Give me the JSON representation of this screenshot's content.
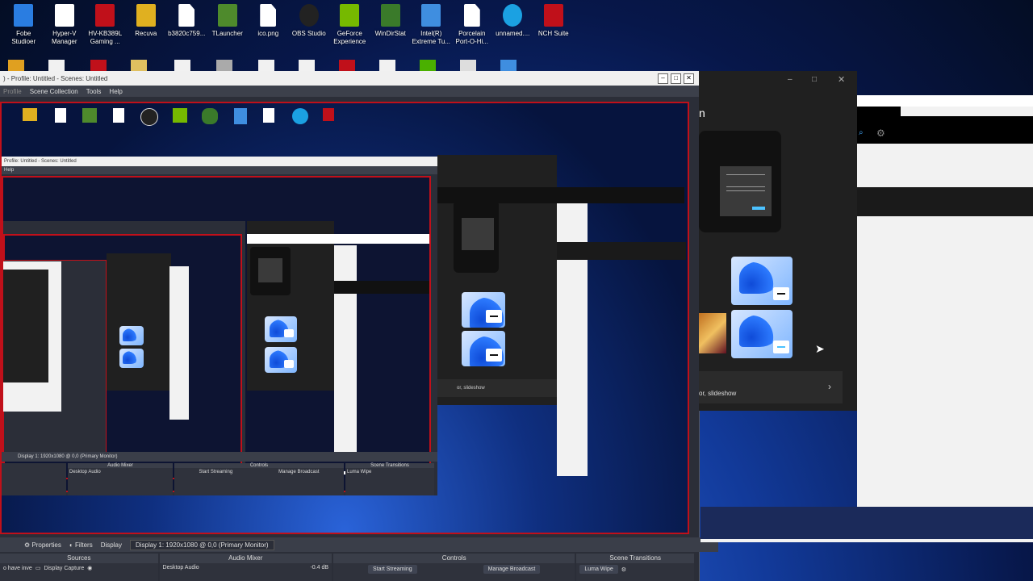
{
  "desktop_icons": [
    {
      "icon": "fobe-icon",
      "label": "Fobe\nStudioer",
      "color": "#2a7de1"
    },
    {
      "icon": "hyperv-icon",
      "label": "Hyper-V\nManager",
      "color": "#ffffff"
    },
    {
      "icon": "hv-icon",
      "label": "HV-KB389L\nGaming ...",
      "color": "#c0101a"
    },
    {
      "icon": "recuva-icon",
      "label": "Recuva",
      "color": "#e0b020"
    },
    {
      "icon": "file-icon",
      "label": "b3820c759...",
      "color": "#ffffff"
    },
    {
      "icon": "tlauncher-icon",
      "label": "TLauncher",
      "color": "#4e8a2c"
    },
    {
      "icon": "file-icon",
      "label": "ico.png",
      "color": "#ffffff"
    },
    {
      "icon": "obs-icon",
      "label": "OBS Studio",
      "color": "#222222"
    },
    {
      "icon": "nvidia-icon",
      "label": "GeForce\nExperience",
      "color": "#76b900"
    },
    {
      "icon": "tree-icon",
      "label": "WinDirStat",
      "color": "#3a7a2a"
    },
    {
      "icon": "intel-icon",
      "label": "Intel(R)\nExtreme Tu...",
      "color": "#3f8ee0"
    },
    {
      "icon": "file-icon",
      "label": "Porcelain\nPort-O-Hi...",
      "color": "#ffffff"
    },
    {
      "icon": "edge-icon",
      "label": "unnamed....",
      "color": "#1ba1e2"
    },
    {
      "icon": "nch-icon",
      "label": "NCH Suite",
      "color": "#c0101a"
    }
  ],
  "obs": {
    "title": ") - Profile: Untitled - Scenes: Untitled",
    "menu": [
      "Profile",
      "Scene Collection",
      "Tools",
      "Help"
    ],
    "toolbar": {
      "properties": "Properties",
      "filters": "Filters",
      "display_label": "Display",
      "display_value": "Display 1: 1920x1080 @ 0,0 (Primary Monitor)"
    },
    "docks": {
      "sources": {
        "title": "Sources",
        "partial_text": "o have inve",
        "item": "Display Capture"
      },
      "audio": {
        "title": "Audio Mixer",
        "channel": "Desktop Audio",
        "db": "-0.4 dB"
      },
      "controls": {
        "title": "Controls",
        "start": "Start Streaming",
        "manage": "Manage Broadcast"
      },
      "transitions": {
        "title": "Scene Transitions",
        "value": "Luma Wipe"
      }
    }
  },
  "settings": {
    "row_text": "or, slideshow",
    "partial_title": "n"
  },
  "nested": {
    "title2": "Profile: Untitled - Scenes: Untitled",
    "menu2": [
      "Scene Collection",
      "Tools",
      "Help"
    ],
    "display2": "Display 1: 1920x1080 @ 0,0 (Primary Monitor)",
    "start2": "Start Streaming",
    "manage2": "Manage Broadcast",
    "luma2": "Luma Wipe",
    "audio2": "Audio Mixer",
    "controls2": "Controls",
    "trans2": "Scene Transitions",
    "desk2": "Desktop Audio",
    "db2": "-0.4 dB",
    "row2": "or, slideshow"
  }
}
